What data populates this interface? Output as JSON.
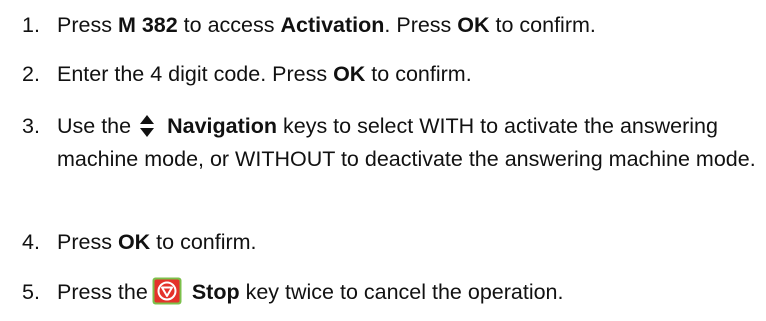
{
  "steps": [
    {
      "number": "1.",
      "t1": "Press ",
      "b1": "M 382",
      "t2": " to access ",
      "b2": "Activation",
      "t3": ". Press ",
      "b3": "OK",
      "t4": " to confirm."
    },
    {
      "number": "2.",
      "t1": "Enter the 4 digit code. Press ",
      "b1": "OK",
      "t2": " to confirm."
    },
    {
      "number": "3.",
      "t1": "Use the",
      "icon": "up-down-navigation-icon",
      "b1": "Navigation",
      "t2": " keys to select  WITH to activate the answering machine mode, or WITHOUT to deactivate the answering machine mode."
    },
    {
      "number": "4.",
      "t1": "Press ",
      "b1": "OK",
      "t2": " to confirm."
    },
    {
      "number": "5.",
      "t1": "Press the",
      "icon": "stop-key-icon",
      "b1": "Stop",
      "t2": " key twice to cancel the operation."
    }
  ],
  "colors": {
    "text": "#111111",
    "stop_red": "#e4322b",
    "stop_green": "#7cc04b"
  }
}
